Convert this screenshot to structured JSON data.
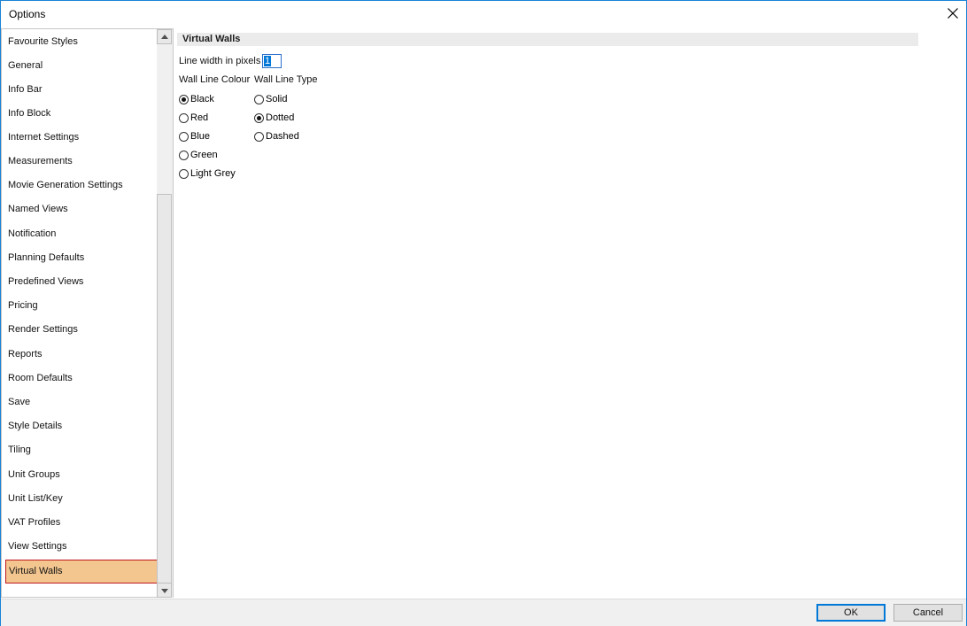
{
  "window": {
    "title": "Options"
  },
  "sidebar": {
    "items": [
      {
        "label": "Favourite Styles"
      },
      {
        "label": "General"
      },
      {
        "label": "Info Bar"
      },
      {
        "label": "Info Block"
      },
      {
        "label": "Internet Settings"
      },
      {
        "label": "Measurements"
      },
      {
        "label": "Movie Generation Settings"
      },
      {
        "label": "Named Views"
      },
      {
        "label": "Notification"
      },
      {
        "label": "Planning Defaults"
      },
      {
        "label": "Predefined Views"
      },
      {
        "label": "Pricing"
      },
      {
        "label": "Render Settings"
      },
      {
        "label": "Reports"
      },
      {
        "label": "Room Defaults"
      },
      {
        "label": "Save"
      },
      {
        "label": "Style Details"
      },
      {
        "label": "Tiling"
      },
      {
        "label": "Unit Groups"
      },
      {
        "label": "Unit List/Key"
      },
      {
        "label": "VAT Profiles"
      },
      {
        "label": "View Settings"
      },
      {
        "label": "Virtual Walls",
        "selected": true
      }
    ]
  },
  "panel": {
    "section_title": "Virtual Walls",
    "line_width_label": "Line width in pixels",
    "line_width_value": "1",
    "wall_line_colour_label": "Wall Line Colour",
    "wall_line_type_label": "Wall Line Type",
    "colours": [
      {
        "label": "Black",
        "checked": true
      },
      {
        "label": "Red",
        "checked": false
      },
      {
        "label": "Blue",
        "checked": false
      },
      {
        "label": "Green",
        "checked": false
      },
      {
        "label": "Light Grey",
        "checked": false
      }
    ],
    "line_types": [
      {
        "label": "Solid",
        "checked": false
      },
      {
        "label": "Dotted",
        "checked": true
      },
      {
        "label": "Dashed",
        "checked": false
      }
    ]
  },
  "footer": {
    "ok_label": "OK",
    "cancel_label": "Cancel"
  },
  "colors": {
    "accent": "#0078d7",
    "selection_bg": "#f3c690",
    "selection_border": "#c0161b"
  }
}
